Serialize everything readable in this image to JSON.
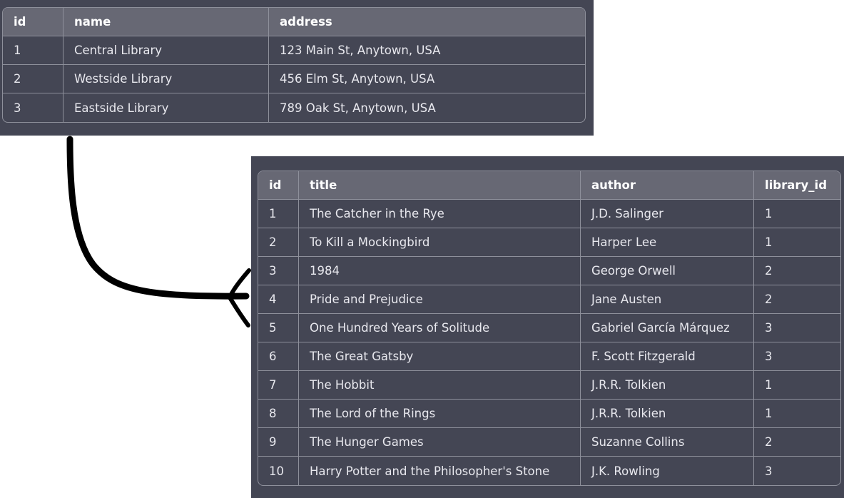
{
  "libraries_table": {
    "columns": [
      "id",
      "name",
      "address"
    ],
    "rows": [
      [
        "1",
        "Central Library",
        "123 Main St, Anytown, USA"
      ],
      [
        "2",
        "Westside Library",
        "456 Elm St, Anytown, USA"
      ],
      [
        "3",
        "Eastside Library",
        "789 Oak St, Anytown, USA"
      ]
    ]
  },
  "books_table": {
    "columns": [
      "id",
      "title",
      "author",
      "library_id"
    ],
    "rows": [
      [
        "1",
        "The Catcher in the Rye",
        "J.D. Salinger",
        "1"
      ],
      [
        "2",
        "To Kill a Mockingbird",
        "Harper Lee",
        "1"
      ],
      [
        "3",
        "1984",
        "George Orwell",
        "2"
      ],
      [
        "4",
        "Pride and Prejudice",
        "Jane Austen",
        "2"
      ],
      [
        "5",
        "One Hundred Years of Solitude",
        "Gabriel García Márquez",
        "3"
      ],
      [
        "6",
        "The Great Gatsby",
        "F. Scott Fitzgerald",
        "3"
      ],
      [
        "7",
        "The Hobbit",
        "J.R.R. Tolkien",
        "1"
      ],
      [
        "8",
        "The Lord of the Rings",
        "J.R.R. Tolkien",
        "1"
      ],
      [
        "9",
        "The Hunger Games",
        "Suzanne Collins",
        "2"
      ],
      [
        "10",
        "Harry Potter and the Philosopher's Stone",
        "J.K. Rowling",
        "3"
      ]
    ]
  },
  "colors": {
    "panel_background": "#444654",
    "header_background": "#676874",
    "grid_border": "#8e909b",
    "text": "#ececf1",
    "arrow": "#000000"
  }
}
